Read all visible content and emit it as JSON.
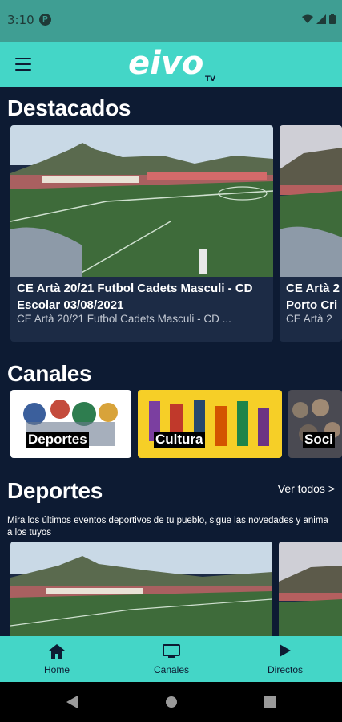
{
  "status": {
    "time": "3:10",
    "app_badge": "P"
  },
  "appbar": {
    "logo_text": "eivo",
    "logo_sub": "TV"
  },
  "destacados": {
    "title": "Destacados",
    "cards": [
      {
        "title": "CE Artà 20/21 Futbol Cadets  Masculi - CD Escolar 03/08/2021",
        "subtitle": "CE Artà 20/21 Futbol Cadets  Masculi - CD ..."
      },
      {
        "title": "CE Artà 2 Porto Cri",
        "subtitle": "CE Artà 2"
      }
    ]
  },
  "canales": {
    "title": "Canales",
    "items": [
      {
        "label": "Deportes"
      },
      {
        "label": "Cultura"
      },
      {
        "label": "Soci"
      }
    ]
  },
  "deportes": {
    "title": "Deportes",
    "see_all": "Ver todos >",
    "description": "Mira los últimos eventos deportivos de tu pueblo, sigue las novedades y anima a los tuyos"
  },
  "bottom_nav": {
    "items": [
      {
        "label": "Home",
        "icon": "home-icon"
      },
      {
        "label": "Canales",
        "icon": "tv-icon"
      },
      {
        "label": "Directos",
        "icon": "play-icon"
      }
    ]
  },
  "colors": {
    "accent": "#44d6c7",
    "background": "#0d1b33",
    "card": "#1c2b45"
  }
}
